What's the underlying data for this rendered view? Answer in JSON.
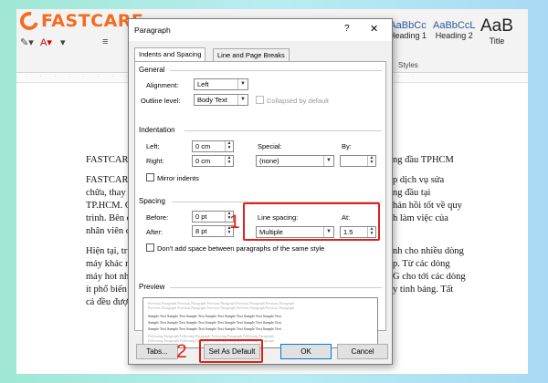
{
  "logo": "FASTCARE",
  "ribbon": {
    "styles": [
      {
        "sample": "AaBbCc",
        "name": "Heading 1"
      },
      {
        "sample": "AaBbCcL",
        "name": "Heading 2"
      },
      {
        "sample": "AaB",
        "name": "Title"
      }
    ],
    "styles_group_label": "Styles"
  },
  "document": {
    "lines": [
      "FASTCARE",
      "FASTCARE",
      "chữa, thay n",
      "TP.HCM. C",
      "trình. Bên c",
      "nhân viên c",
      "Hiện tại, trư",
      "máy khác n",
      "máy hot nh",
      "ít phổ biến",
      "cả đều được"
    ],
    "right_lines": [
      "ng đầu TPHCM",
      "p dịch vụ sửa",
      "ng đầu tại",
      "hản hồi tốt về quy",
      "h làm việc của",
      "nh cho nhiều dòng",
      "p. Từ các dòng",
      "G cho tới các dòng",
      "y tính bảng. Tất"
    ]
  },
  "dialog": {
    "title": "Paragraph",
    "help": "?",
    "close": "✕",
    "tabs": [
      "Indents and Spacing",
      "Line and Page Breaks"
    ],
    "general": {
      "heading": "General",
      "alignment_label": "Alignment:",
      "alignment_value": "Left",
      "outline_label": "Outline level:",
      "outline_value": "Body Text",
      "collapsed_label": "Collapsed by default"
    },
    "indentation": {
      "heading": "Indentation",
      "left_label": "Left:",
      "left_value": "0 cm",
      "right_label": "Right:",
      "right_value": "0 cm",
      "special_label": "Special:",
      "special_value": "(none)",
      "by_label": "By:",
      "by_value": "",
      "mirror_label": "Mirror indents"
    },
    "spacing": {
      "heading": "Spacing",
      "before_label": "Before:",
      "before_value": "0 pt",
      "after_label": "After:",
      "after_value": "8 pt",
      "line_spacing_label": "Line spacing:",
      "line_spacing_value": "Multiple",
      "at_label": "At:",
      "at_value": "1.5",
      "dont_add_label": "Don't add space between paragraphs of the same style"
    },
    "preview": {
      "heading": "Preview",
      "prev_text": "Previous Paragraph Previous Paragraph Previous Paragraph Previous Paragraph Previous Paragraph",
      "sample_text": "Sample Text Sample Text Sample Text Sample Text Sample Text Sample Text Sample Text",
      "following_text": "Following Paragraph Following Paragraph Following Paragraph Following Paragraph"
    },
    "buttons": {
      "tabs": "Tabs...",
      "set_default": "Set As Default",
      "ok": "OK",
      "cancel": "Cancel"
    }
  },
  "annotations": {
    "one": "1",
    "two": "2"
  },
  "colors": {
    "annotation": "#e0201b",
    "brand": "#f26c21",
    "dialog_bg": "#f0f0f0"
  }
}
